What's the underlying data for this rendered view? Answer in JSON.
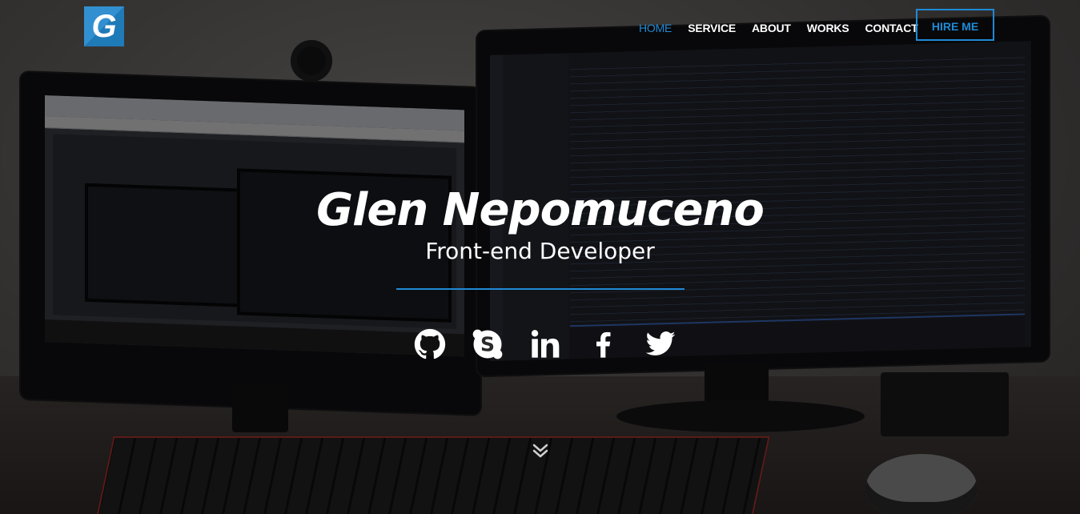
{
  "navbar": {
    "logo_letter": "G",
    "items": [
      {
        "label": "HOME",
        "active": true
      },
      {
        "label": "SERVICE",
        "active": false
      },
      {
        "label": "ABOUT",
        "active": false
      },
      {
        "label": "WORKS",
        "active": false
      },
      {
        "label": "CONTACT",
        "active": false
      }
    ],
    "cta_label": "HIRE ME"
  },
  "hero": {
    "name": "Glen Nepomuceno",
    "role": "Front-end Developer"
  },
  "social": [
    {
      "icon": "github-icon"
    },
    {
      "icon": "skype-icon"
    },
    {
      "icon": "linkedin-icon"
    },
    {
      "icon": "facebook-icon"
    },
    {
      "icon": "twitter-icon"
    }
  ],
  "scroll_icon": "chevron-double-down-icon",
  "colors": {
    "accent": "#1f8ad6",
    "overlay": "#08080a",
    "text": "#ffffff"
  }
}
